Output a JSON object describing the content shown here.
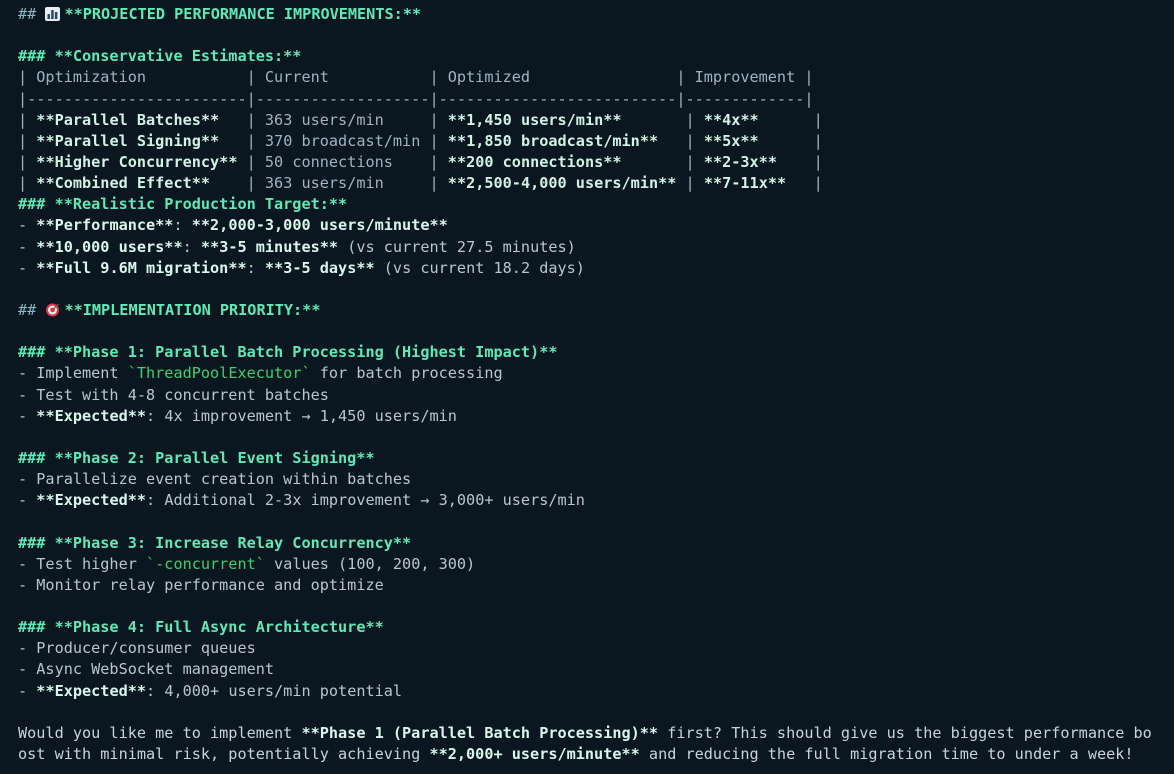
{
  "heading1": {
    "prefix": "## ",
    "icon": "bar-chart-icon",
    "text": "**PROJECTED PERFORMANCE IMPROVEMENTS:**"
  },
  "conservative": {
    "heading": "### **Conservative Estimates:**",
    "table": {
      "header": "| Optimization           | Current           | Optimized                | Improvement |",
      "separator": "|------------------------|-------------------|--------------------------|-------------|",
      "rows": [
        {
          "c1": "**Parallel Batches**  ",
          "c2": "363 users/min     ",
          "c3": "**1,450 users/min**      ",
          "c4": "**4x**      "
        },
        {
          "c1": "**Parallel Signing**  ",
          "c2": "370 broadcast/min ",
          "c3": "**1,850 broadcast/min**  ",
          "c4": "**5x**      "
        },
        {
          "c1": "**Higher Concurrency**",
          "c2": "50 connections    ",
          "c3": "**200 connections**      ",
          "c4": "**2-3x**    "
        },
        {
          "c1": "**Combined Effect**   ",
          "c2": "363 users/min     ",
          "c3": "**2,500-4,000 users/min**",
          "c4": "**7-11x**   "
        }
      ]
    }
  },
  "realistic": {
    "heading": "### **Realistic Production Target:**",
    "items": [
      {
        "b1": "**Performance**",
        "mid": ": ",
        "b2": "**2,000-3,000 users/minute**",
        "rest": ""
      },
      {
        "b1": "**10,000 users**",
        "mid": ": ",
        "b2": "**3-5 minutes**",
        "rest": " (vs current 27.5 minutes)"
      },
      {
        "b1": "**Full 9.6M migration**",
        "mid": ": ",
        "b2": "**3-5 days**",
        "rest": " (vs current 18.2 days)"
      }
    ]
  },
  "heading2": {
    "prefix": "## ",
    "icon": "target-icon",
    "text": "**IMPLEMENTATION PRIORITY:**"
  },
  "phase1": {
    "heading": "### **Phase 1: Parallel Batch Processing (Highest Impact)**",
    "item1_pre": "- Implement ",
    "item1_code": "`ThreadPoolExecutor`",
    "item1_post": " for batch processing",
    "item2": "- Test with 4-8 concurrent batches",
    "item3_bold": "**Expected**",
    "item3_rest": ": 4x improvement → 1,450 users/min"
  },
  "phase2": {
    "heading": "### **Phase 2: Parallel Event Signing**",
    "item1": "- Parallelize event creation within batches",
    "item2_bold": "**Expected**",
    "item2_rest": ": Additional 2-3x improvement → 3,000+ users/min"
  },
  "phase3": {
    "heading": "### **Phase 3: Increase Relay Concurrency**",
    "item1_pre": "- Test higher ",
    "item1_code": "`-concurrent`",
    "item1_post": " values (100, 200, 300)",
    "item2": "- Monitor relay performance and optimize"
  },
  "phase4": {
    "heading": "### **Phase 4: Full Async Architecture**",
    "item1": "- Producer/consumer queues",
    "item2": "- Async WebSocket management",
    "item3_bold": "**Expected**",
    "item3_rest": ": 4,000+ users/min potential"
  },
  "footer": {
    "line1_pre": "Would you like me to implement ",
    "line1_bold": "**Phase 1 (Parallel Batch Processing)**",
    "line1_post": " first? This should give us the biggest performance bo",
    "line2_pre": "ost with minimal risk, potentially achieving ",
    "line2_bold": "**2,000+ users/minute**",
    "line2_post": " and reducing the full migration time to under a week!"
  }
}
